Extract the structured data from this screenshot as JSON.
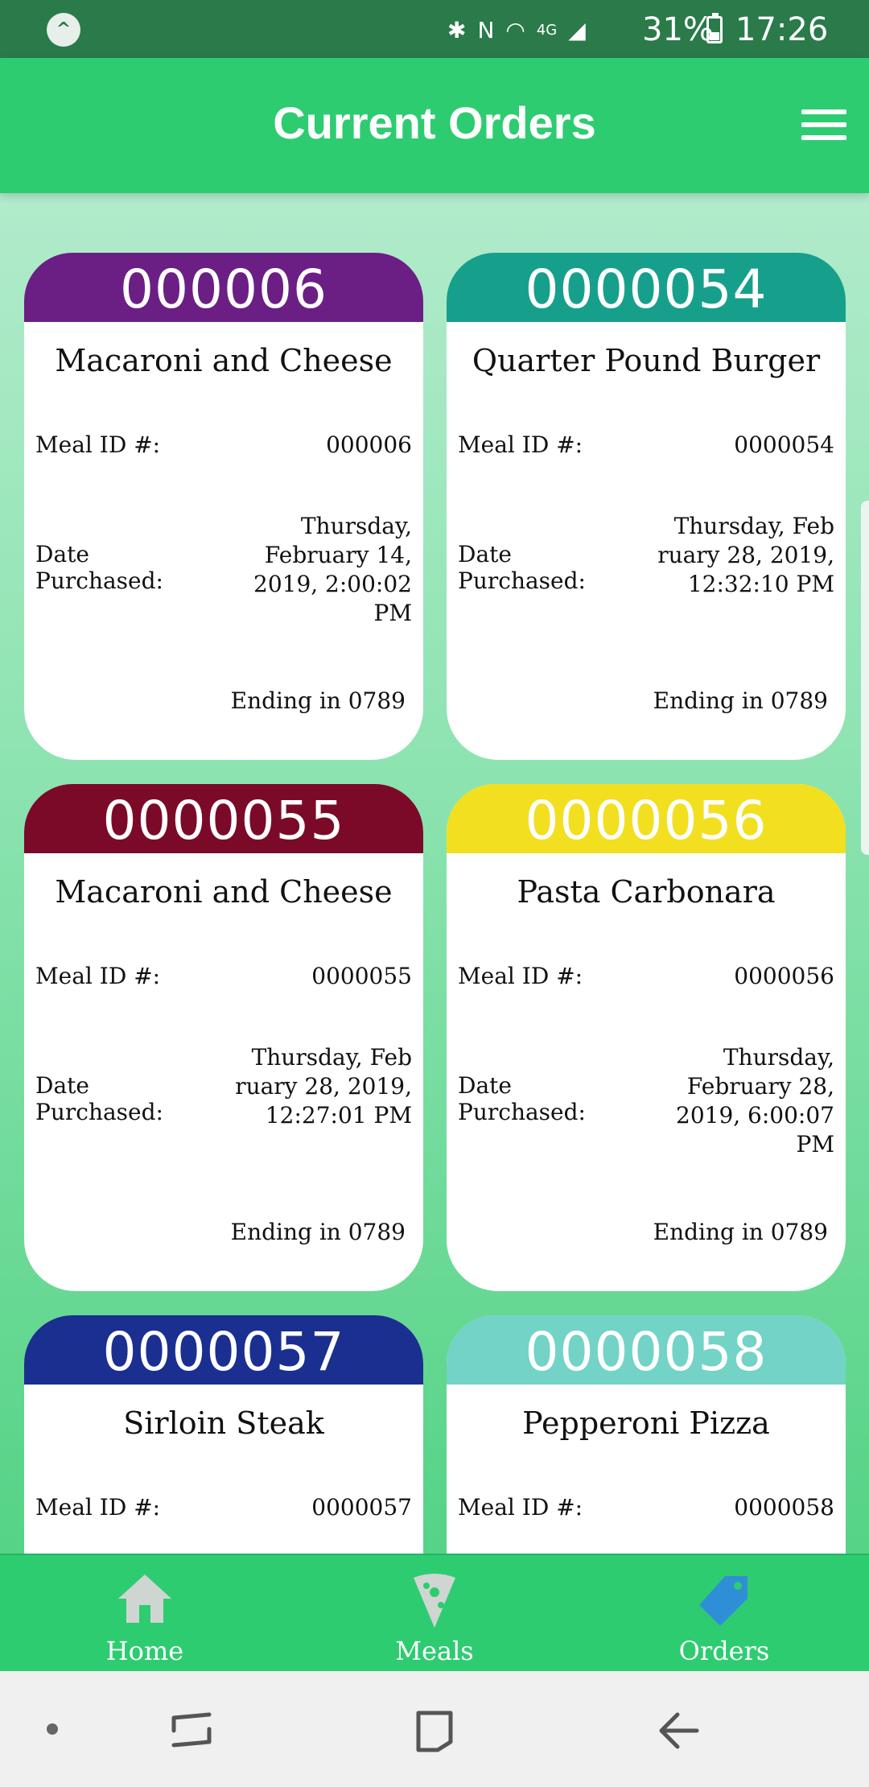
{
  "status": {
    "network": "4G",
    "battery": "31%",
    "time": "17:26"
  },
  "header": {
    "title": "Current Orders"
  },
  "orders": [
    {
      "number": "000006",
      "color": "#6b1f84",
      "meal_name": "Macaroni and Cheese",
      "meal_id_label": "Meal ID #:",
      "meal_id": "000006",
      "date_label": "Date Purchased:",
      "date_lines": [
        "Thursday,",
        "February 14,",
        "2019, 2:00:02 PM"
      ],
      "ending": "Ending in 0789"
    },
    {
      "number": "0000054",
      "color": "#16a08c",
      "meal_name": "Quarter Pound Burger",
      "meal_id_label": "Meal ID #:",
      "meal_id": "0000054",
      "date_label": "Date Purchased:",
      "date_lines": [
        "Thursday, Feb",
        "ruary 28, 2019,",
        "12:32:10 PM"
      ],
      "ending": "Ending in 0789"
    },
    {
      "number": "0000055",
      "color": "#7b0a28",
      "meal_name": "Macaroni and Cheese",
      "meal_id_label": "Meal ID #:",
      "meal_id": "0000055",
      "date_label": "Date Purchased:",
      "date_lines": [
        "Thursday, Feb",
        "ruary 28, 2019,",
        "12:27:01 PM"
      ],
      "ending": "Ending in 0789"
    },
    {
      "number": "0000056",
      "color": "#f2df20",
      "meal_name": "Pasta Carbonara",
      "meal_id_label": "Meal ID #:",
      "meal_id": "0000056",
      "date_label": "Date Purchased:",
      "date_lines": [
        "Thursday,",
        "February 28,",
        "2019, 6:00:07 PM"
      ],
      "ending": "Ending in 0789"
    },
    {
      "number": "0000057",
      "color": "#1a2f8f",
      "meal_name": "Sirloin Steak",
      "meal_id_label": "Meal ID #:",
      "meal_id": "0000057"
    },
    {
      "number": "0000058",
      "color": "#72d3c6",
      "meal_name": "Pepperoni Pizza",
      "meal_id_label": "Meal ID #:",
      "meal_id": "0000058"
    }
  ],
  "nav": {
    "home": "Home",
    "meals": "Meals",
    "orders": "Orders",
    "active": "orders",
    "active_color": "#2f8fd6",
    "inactive_color": "#cfd6d2"
  }
}
